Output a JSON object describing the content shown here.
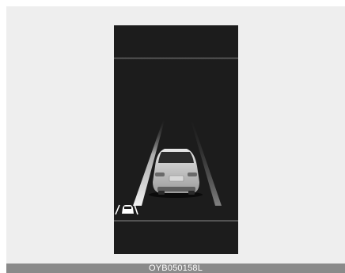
{
  "caption": {
    "code": "OYB050158L"
  },
  "display": {
    "icons": [
      "lane-line-left",
      "lane-line-right",
      "leading-vehicle-icon",
      "lane-assist-indicator-icon"
    ]
  },
  "colors": {
    "background": "#eeeeee",
    "screen": "#1c1c1c",
    "lane_line": "#e8e8e8",
    "caption_bar": "#8a8a8a"
  }
}
